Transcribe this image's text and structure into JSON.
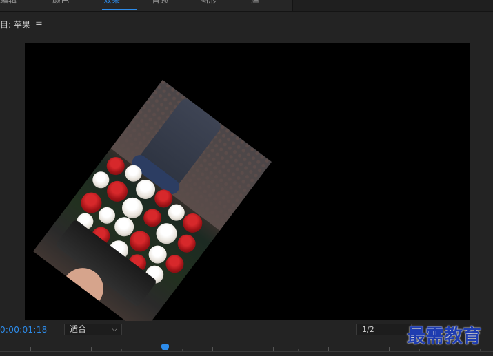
{
  "workspace_tabs": [
    {
      "label": "编辑",
      "active": false
    },
    {
      "label": "颜色",
      "active": false
    },
    {
      "label": "效果",
      "active": true
    },
    {
      "label": "音频",
      "active": false
    },
    {
      "label": "图形",
      "active": false
    },
    {
      "label": "库",
      "active": false
    }
  ],
  "panel": {
    "title": "目: 苹果",
    "menu_icon": "hamburger-menu-icon"
  },
  "monitor": {
    "rotation_degrees": 37
  },
  "controls": {
    "timecode": "0:00:01:18",
    "fit_value": "适合",
    "resolution_value": "1/2"
  },
  "watermark": {
    "text": "最需教育"
  },
  "colors": {
    "accent": "#2d8ceb",
    "panel_bg": "#232323",
    "monitor_bg": "#000000",
    "watermark": "#1f3db0"
  }
}
